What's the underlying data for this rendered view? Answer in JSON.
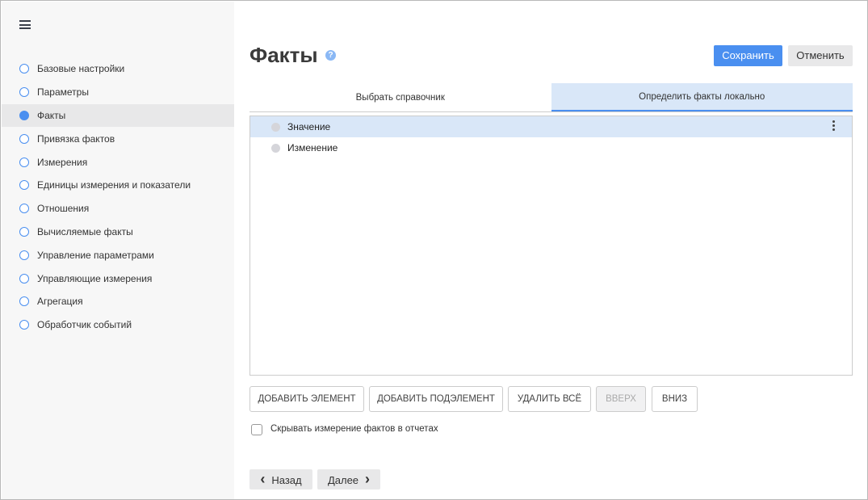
{
  "sidebar": {
    "items": [
      {
        "label": "Базовые настройки",
        "active": false
      },
      {
        "label": "Параметры",
        "active": false
      },
      {
        "label": "Факты",
        "active": true
      },
      {
        "label": "Привязка фактов",
        "active": false
      },
      {
        "label": "Измерения",
        "active": false
      },
      {
        "label": "Единицы измерения и показатели",
        "active": false
      },
      {
        "label": "Отношения",
        "active": false
      },
      {
        "label": "Вычисляемые факты",
        "active": false
      },
      {
        "label": "Управление параметрами",
        "active": false
      },
      {
        "label": "Управляющие измерения",
        "active": false
      },
      {
        "label": "Агрегация",
        "active": false
      },
      {
        "label": "Обработчик событий",
        "active": false
      }
    ]
  },
  "header": {
    "title": "Факты",
    "help": "?",
    "save_label": "Сохранить",
    "cancel_label": "Отменить"
  },
  "tabs": [
    {
      "label": "Выбрать справочник"
    },
    {
      "label": "Определить факты локально"
    }
  ],
  "list": {
    "items": [
      {
        "label": "Значение"
      },
      {
        "label": "Изменение"
      }
    ]
  },
  "actions": {
    "add": "ДОБАВИТЬ ЭЛЕМЕНТ",
    "add_sub": "ДОБАВИТЬ ПОДЭЛЕМЕНТ",
    "delete_all": "УДАЛИТЬ ВСЁ",
    "up": "ВВЕРХ",
    "down": "ВНИЗ"
  },
  "hide_checkbox": {
    "label": "Скрывать измерение фактов в отчетах",
    "checked": false
  },
  "nav": {
    "back": "Назад",
    "next": "Далее",
    "back_icon": "‹",
    "next_icon": "›"
  },
  "colors": {
    "accent": "#4a8ff0",
    "selected_bg": "#d9e7f8"
  }
}
